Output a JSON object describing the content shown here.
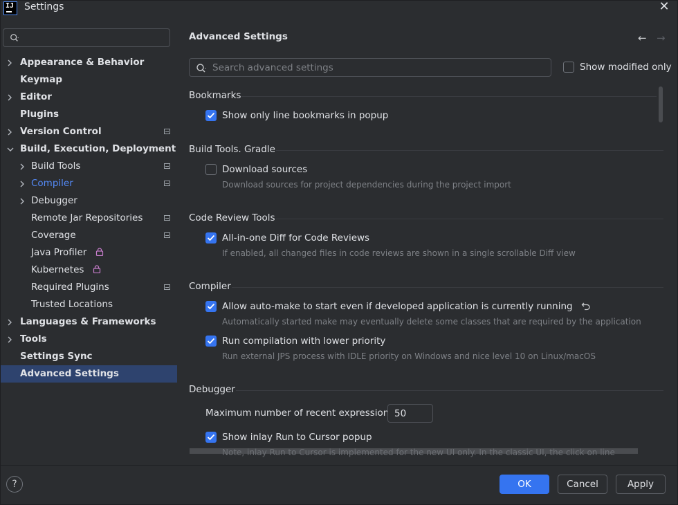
{
  "window": {
    "title": "Settings",
    "logo_text": "IJ"
  },
  "sidebar": {
    "search_placeholder": "",
    "items": [
      {
        "label": "Appearance & Behavior"
      },
      {
        "label": "Keymap"
      },
      {
        "label": "Editor"
      },
      {
        "label": "Plugins"
      },
      {
        "label": "Version Control"
      },
      {
        "label": "Build, Execution, Deployment"
      },
      {
        "label": "Build Tools"
      },
      {
        "label": "Compiler"
      },
      {
        "label": "Debugger"
      },
      {
        "label": "Remote Jar Repositories"
      },
      {
        "label": "Coverage"
      },
      {
        "label": "Java Profiler"
      },
      {
        "label": "Kubernetes"
      },
      {
        "label": "Required Plugins"
      },
      {
        "label": "Trusted Locations"
      },
      {
        "label": "Languages & Frameworks"
      },
      {
        "label": "Tools"
      },
      {
        "label": "Settings Sync"
      },
      {
        "label": "Advanced Settings"
      }
    ]
  },
  "content": {
    "title": "Advanced Settings",
    "search_placeholder": "Search advanced settings",
    "show_modified_label": "Show modified only",
    "sections": {
      "bookmarks": {
        "header": "Bookmarks",
        "opt1": "Show only line bookmarks in popup"
      },
      "gradle": {
        "header": "Build Tools. Gradle",
        "opt1": "Download sources",
        "opt1_desc": "Download sources for project dependencies during the project import"
      },
      "review": {
        "header": "Code Review Tools",
        "opt1": "All-in-one Diff for Code Reviews",
        "opt1_desc": "If enabled, all changed files in code reviews are shown in a single scrollable Diff view"
      },
      "compiler": {
        "header": "Compiler",
        "opt1": "Allow auto-make to start even if developed application is currently running",
        "opt1_desc": "Automatically started make may eventually delete some classes that are required by the application",
        "opt2": "Run compilation with lower priority",
        "opt2_desc": "Run external JPS process with IDLE priority on Windows and nice level 10 on Linux/macOS"
      },
      "debugger": {
        "header": "Debugger",
        "max_expr_label": "Maximum number of recent expressions:",
        "max_expr_value": "50",
        "opt1": "Show inlay Run to Cursor popup",
        "cut_text": "Note, inlay Run to Cursor is implemented for the new UI only. In the classic UI, the click on line"
      }
    }
  },
  "footer": {
    "help": "?",
    "ok": "OK",
    "cancel": "Cancel",
    "apply": "Apply"
  },
  "colors": {
    "accent": "#3574f0",
    "selected_bg": "#2e436e",
    "link": "#548af7",
    "background": "#2b2d30"
  }
}
